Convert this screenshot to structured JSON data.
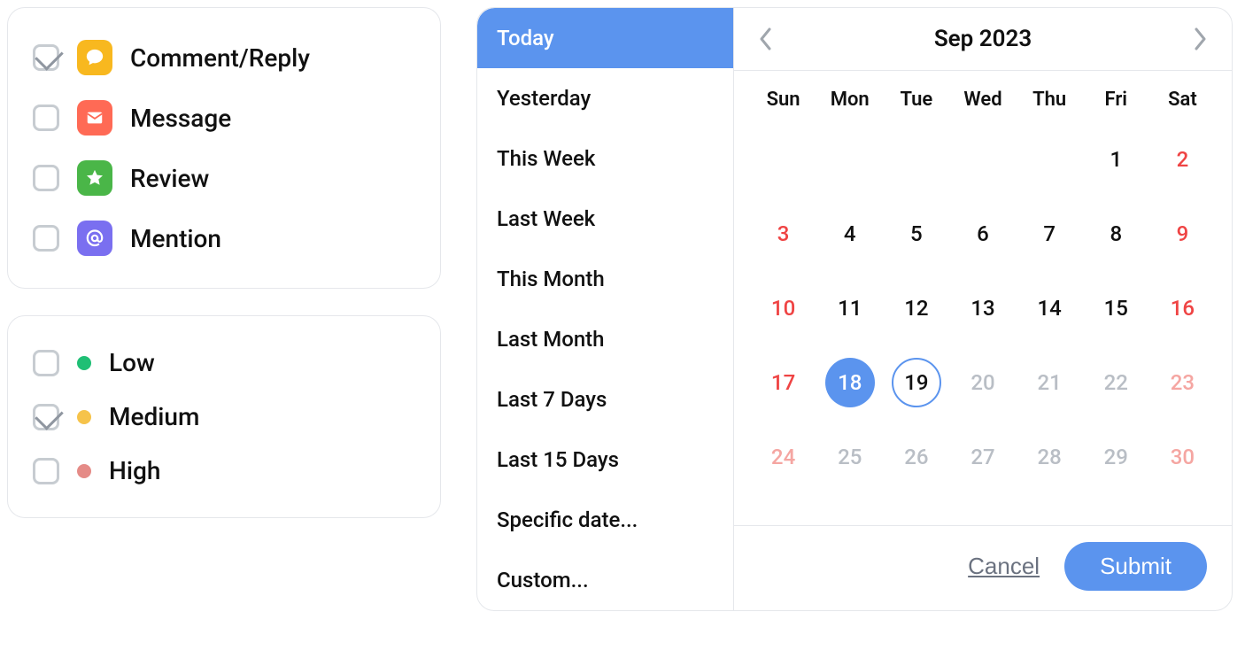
{
  "type_filters": {
    "items": [
      {
        "label": "Comment/Reply",
        "checked": true,
        "icon": "comment-icon",
        "color": "yellow"
      },
      {
        "label": "Message",
        "checked": false,
        "icon": "mail-icon",
        "color": "red"
      },
      {
        "label": "Review",
        "checked": false,
        "icon": "star-icon",
        "color": "green"
      },
      {
        "label": "Mention",
        "checked": false,
        "icon": "at-icon",
        "color": "purple"
      }
    ]
  },
  "priority_filters": {
    "items": [
      {
        "label": "Low",
        "checked": false,
        "dot": "green"
      },
      {
        "label": "Medium",
        "checked": true,
        "dot": "yellow"
      },
      {
        "label": "High",
        "checked": false,
        "dot": "red"
      }
    ]
  },
  "date_presets": {
    "items": [
      {
        "label": "Today",
        "active": true
      },
      {
        "label": "Yesterday",
        "active": false
      },
      {
        "label": "This Week",
        "active": false
      },
      {
        "label": "Last Week",
        "active": false
      },
      {
        "label": "This Month",
        "active": false
      },
      {
        "label": "Last Month",
        "active": false
      },
      {
        "label": "Last 7 Days",
        "active": false
      },
      {
        "label": "Last 15 Days",
        "active": false
      },
      {
        "label": "Specific date...",
        "active": false
      },
      {
        "label": "Custom...",
        "active": false
      }
    ]
  },
  "calendar": {
    "title": "Sep 2023",
    "dow": [
      "Sun",
      "Mon",
      "Tue",
      "Wed",
      "Thu",
      "Fri",
      "Sat"
    ],
    "days": [
      {
        "n": "",
        "t": "empty"
      },
      {
        "n": "",
        "t": "empty"
      },
      {
        "n": "",
        "t": "empty"
      },
      {
        "n": "",
        "t": "empty"
      },
      {
        "n": "",
        "t": "empty"
      },
      {
        "n": "1",
        "t": "black"
      },
      {
        "n": "2",
        "t": "red"
      },
      {
        "n": "3",
        "t": "red"
      },
      {
        "n": "4",
        "t": "black"
      },
      {
        "n": "5",
        "t": "black"
      },
      {
        "n": "6",
        "t": "black"
      },
      {
        "n": "7",
        "t": "black"
      },
      {
        "n": "8",
        "t": "black"
      },
      {
        "n": "9",
        "t": "red"
      },
      {
        "n": "10",
        "t": "red"
      },
      {
        "n": "11",
        "t": "black"
      },
      {
        "n": "12",
        "t": "black"
      },
      {
        "n": "13",
        "t": "black"
      },
      {
        "n": "14",
        "t": "black"
      },
      {
        "n": "15",
        "t": "black"
      },
      {
        "n": "16",
        "t": "red"
      },
      {
        "n": "17",
        "t": "red"
      },
      {
        "n": "18",
        "t": "selected"
      },
      {
        "n": "19",
        "t": "outlined"
      },
      {
        "n": "20",
        "t": "gray"
      },
      {
        "n": "21",
        "t": "gray"
      },
      {
        "n": "22",
        "t": "gray"
      },
      {
        "n": "23",
        "t": "lightred"
      },
      {
        "n": "24",
        "t": "lightred"
      },
      {
        "n": "25",
        "t": "gray"
      },
      {
        "n": "26",
        "t": "gray"
      },
      {
        "n": "27",
        "t": "gray"
      },
      {
        "n": "28",
        "t": "gray"
      },
      {
        "n": "29",
        "t": "gray"
      },
      {
        "n": "30",
        "t": "lightred"
      }
    ],
    "cancel_label": "Cancel",
    "submit_label": "Submit"
  }
}
